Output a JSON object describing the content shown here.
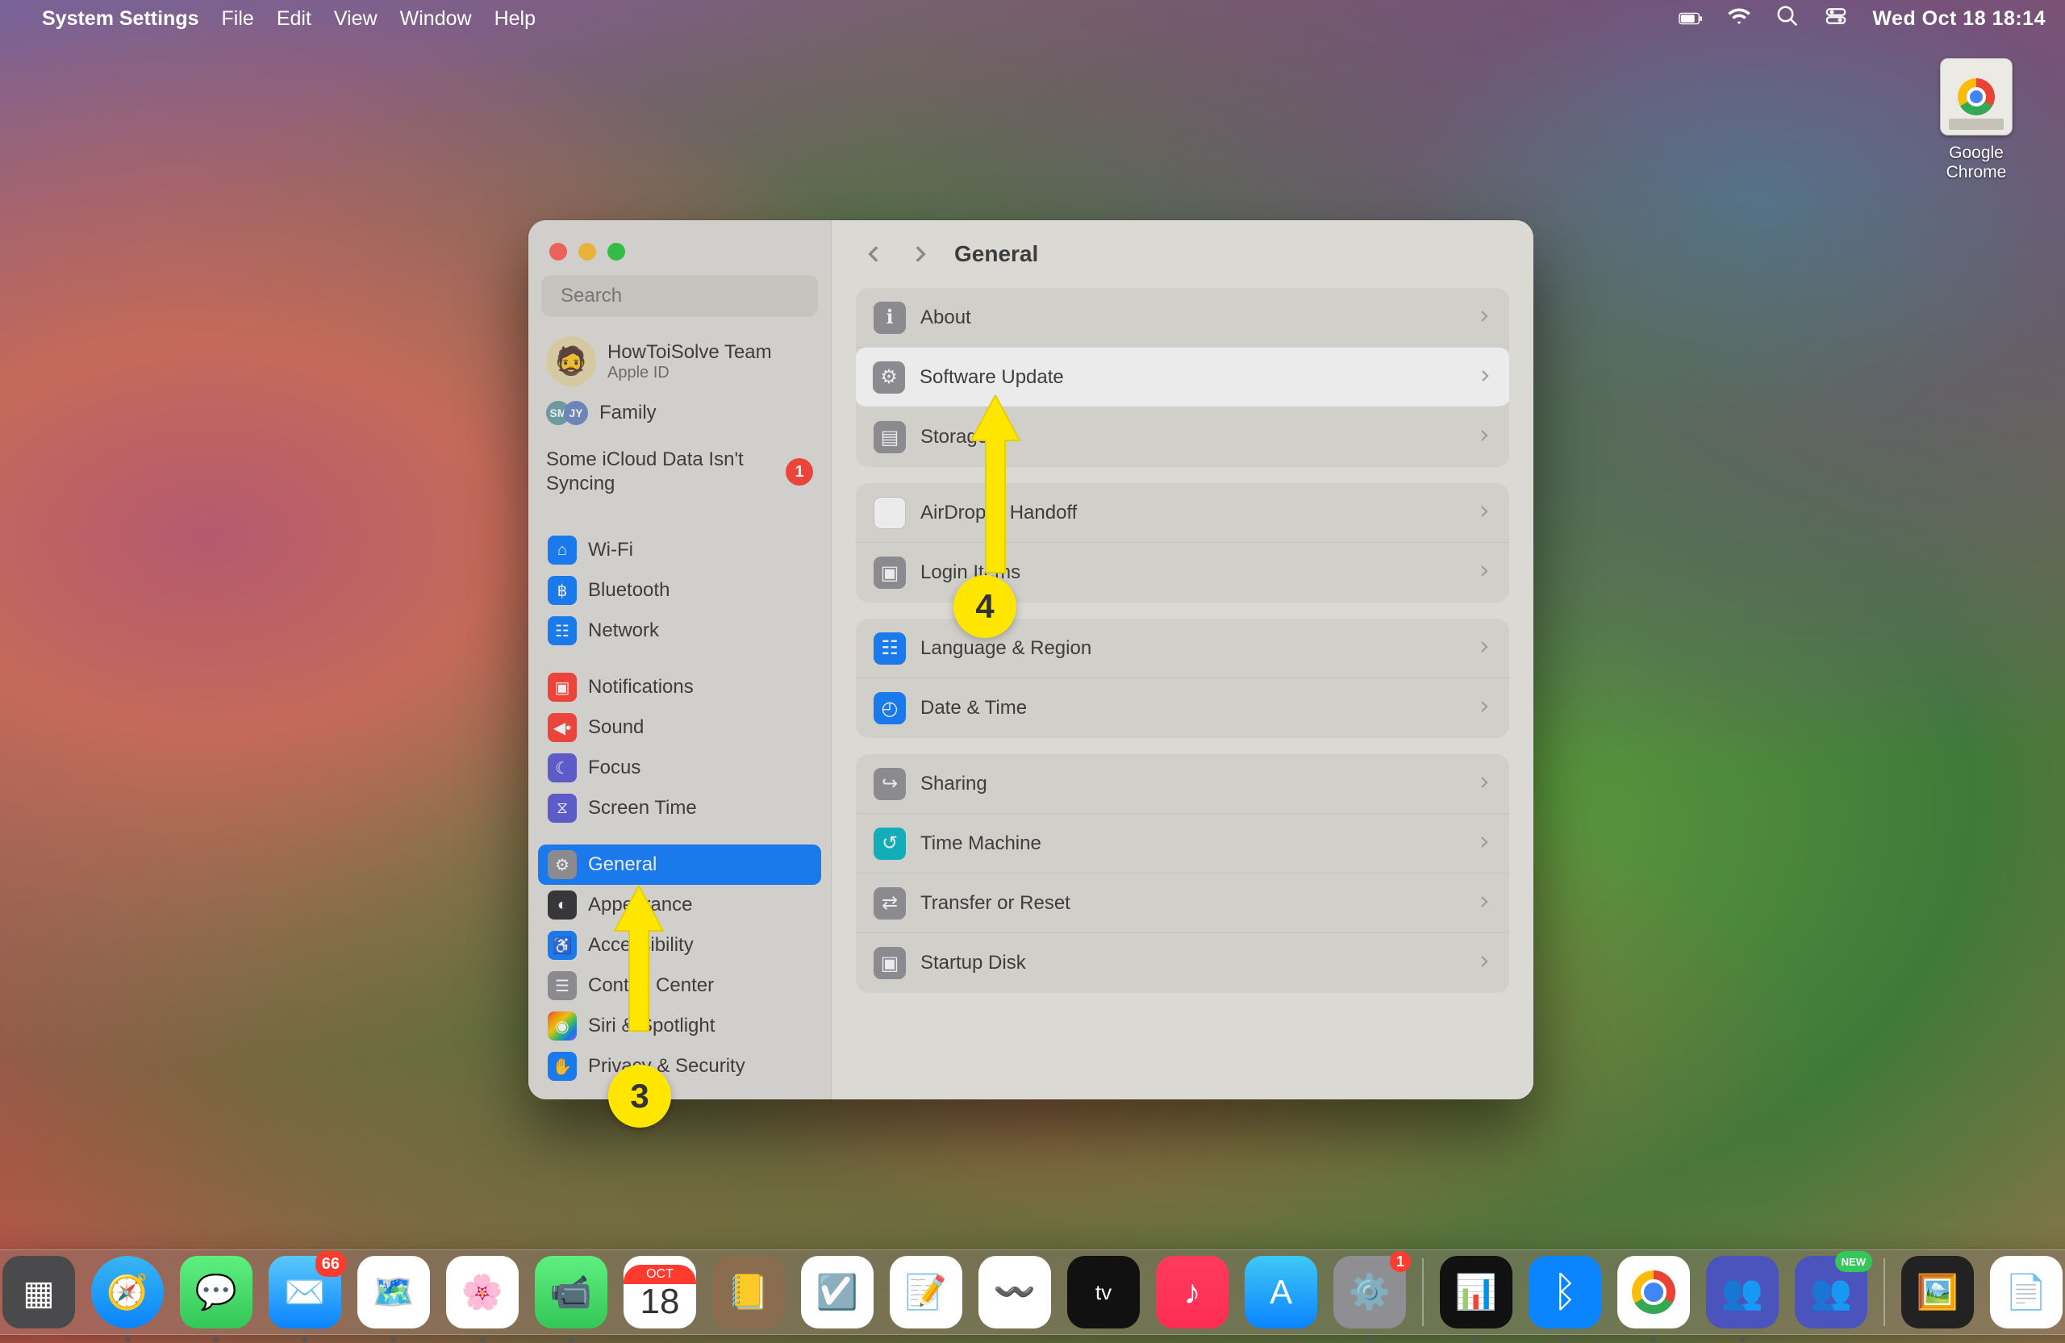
{
  "menubar": {
    "app_name": "System Settings",
    "items": [
      "File",
      "Edit",
      "View",
      "Window",
      "Help"
    ],
    "datetime": "Wed Oct 18  18:14"
  },
  "desktop": {
    "chrome_label": "Google Chrome"
  },
  "window": {
    "search_placeholder": "Search",
    "account_name": "HowToiSolve Team",
    "account_sub": "Apple ID",
    "family_label": "Family",
    "sync_text": "Some iCloud Data Isn't Syncing",
    "sync_badge": "1",
    "sidebar_groups": [
      [
        {
          "key": "wifi",
          "label": "Wi-Fi",
          "bg": "bg-blue",
          "glyph": "⌂"
        },
        {
          "key": "bluetooth",
          "label": "Bluetooth",
          "bg": "bg-blue",
          "glyph": "฿"
        },
        {
          "key": "network",
          "label": "Network",
          "bg": "bg-blue",
          "glyph": "☷"
        }
      ],
      [
        {
          "key": "notifications",
          "label": "Notifications",
          "bg": "bg-red",
          "glyph": "▣"
        },
        {
          "key": "sound",
          "label": "Sound",
          "bg": "bg-red",
          "glyph": "◀•"
        },
        {
          "key": "focus",
          "label": "Focus",
          "bg": "bg-purple",
          "glyph": "☾"
        },
        {
          "key": "screentime",
          "label": "Screen Time",
          "bg": "bg-purple",
          "glyph": "⧖"
        }
      ],
      [
        {
          "key": "general",
          "label": "General",
          "bg": "bg-grey",
          "glyph": "⚙",
          "active": true
        },
        {
          "key": "appearance",
          "label": "Appearance",
          "bg": "bg-black",
          "glyph": "◐"
        },
        {
          "key": "accessibility",
          "label": "Accessibility",
          "bg": "bg-blue",
          "glyph": "♿"
        },
        {
          "key": "controlcenter",
          "label": "Control Center",
          "bg": "bg-grey",
          "glyph": "☰"
        },
        {
          "key": "siri",
          "label": "Siri & Spotlight",
          "bg": "bg-multi",
          "glyph": "◉"
        },
        {
          "key": "privacy",
          "label": "Privacy & Security",
          "bg": "bg-blue",
          "glyph": "✋"
        }
      ]
    ],
    "content_title": "General",
    "content_groups": [
      [
        {
          "key": "about",
          "label": "About",
          "bg": "bg-grey",
          "glyph": "ℹ"
        },
        {
          "key": "software-update",
          "label": "Software Update",
          "bg": "bg-grey",
          "glyph": "⚙",
          "highlight": true
        },
        {
          "key": "storage",
          "label": "Storage",
          "bg": "bg-grey",
          "glyph": "▤"
        }
      ],
      [
        {
          "key": "airdrop",
          "label": "AirDrop & Handoff",
          "bg": "bg-white",
          "glyph": "◎"
        },
        {
          "key": "login",
          "label": "Login Items",
          "bg": "bg-grey",
          "glyph": "▣"
        }
      ],
      [
        {
          "key": "lang",
          "label": "Language & Region",
          "bg": "bg-blue",
          "glyph": "☷"
        },
        {
          "key": "datetime",
          "label": "Date & Time",
          "bg": "bg-blue",
          "glyph": "◴"
        }
      ],
      [
        {
          "key": "sharing",
          "label": "Sharing",
          "bg": "bg-grey",
          "glyph": "↪"
        },
        {
          "key": "timemachine",
          "label": "Time Machine",
          "bg": "bg-teal",
          "glyph": "↺"
        },
        {
          "key": "transfer",
          "label": "Transfer or Reset",
          "bg": "bg-grey",
          "glyph": "⇄"
        },
        {
          "key": "startup",
          "label": "Startup Disk",
          "bg": "bg-grey",
          "glyph": "▣"
        }
      ]
    ]
  },
  "annotations": {
    "step3": "3",
    "step4": "4"
  },
  "dock": {
    "mail_badge": "66",
    "settings_badge": "1",
    "cal_month": "OCT",
    "cal_day": "18",
    "teams_new": "NEW"
  }
}
